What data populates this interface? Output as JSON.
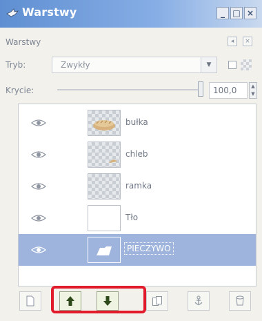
{
  "window": {
    "title": "Warstwy",
    "controls": {
      "minimize": "_",
      "maximize": "□",
      "close": "×"
    }
  },
  "panel": {
    "title": "Warstwy",
    "mode_label": "Tryb:",
    "mode_value": "Zwykły",
    "opacity_label": "Krycie:",
    "opacity_value": "100,0"
  },
  "layers": [
    {
      "name": "bułka",
      "visible": true,
      "thumb": "bulka"
    },
    {
      "name": "chleb",
      "visible": true,
      "thumb": "transparent"
    },
    {
      "name": "ramka",
      "visible": true,
      "thumb": "transparent"
    },
    {
      "name": "Tło",
      "visible": true,
      "thumb": "white"
    },
    {
      "name": "PIECZYWO",
      "visible": true,
      "thumb": "folder",
      "selected": true
    }
  ],
  "toolbar": {
    "items": [
      "new-layer-icon",
      "raise-layer-icon",
      "lower-layer-icon",
      "duplicate-layer-icon",
      "anchor-layer-icon",
      "delete-layer-icon"
    ],
    "highlight_color": "#e11b2b"
  },
  "colors": {
    "title_bar": "#5f8fd2",
    "selected_row": "#9eb4dc"
  }
}
